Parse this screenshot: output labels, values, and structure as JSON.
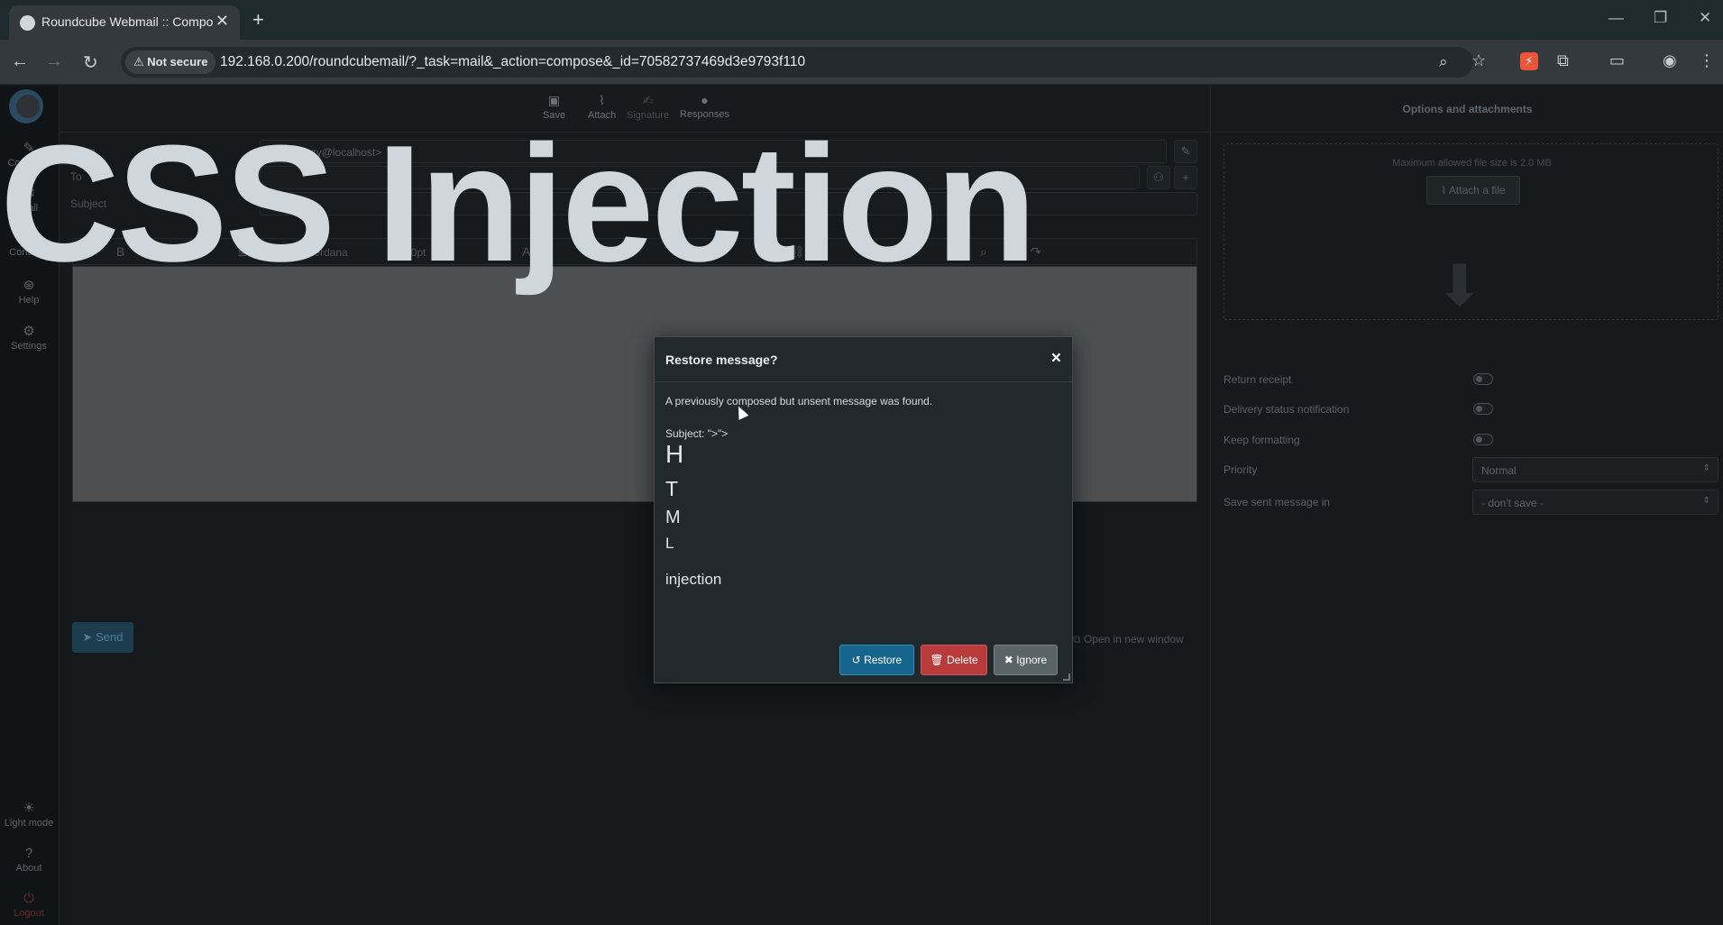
{
  "browser": {
    "tab_title": "Roundcube Webmail :: Compose",
    "tab_close": "✕",
    "new_tab": "+",
    "not_secure": "Not secure",
    "url": "192.168.0.200/roundcubemail/?_task=mail&_action=compose&_id=70582737469d3e9793f110"
  },
  "sidebar": {
    "items": [
      {
        "label": "Compose",
        "icon": "compose-icon"
      },
      {
        "label": "Mail",
        "icon": "mail-icon"
      },
      {
        "label": "Contacts",
        "icon": "contacts-icon"
      },
      {
        "label": "Help",
        "icon": "help-icon"
      },
      {
        "label": "Settings",
        "icon": "gear-icon"
      }
    ],
    "bottom": [
      {
        "label": "Light mode",
        "icon": "sun-icon"
      },
      {
        "label": "About",
        "icon": "question-icon"
      },
      {
        "label": "Logout",
        "icon": "power-icon"
      }
    ]
  },
  "toolbar": {
    "save": "Save",
    "attach": "Attach",
    "signature": "Signature",
    "responses": "Responses"
  },
  "compose": {
    "from_label": "From",
    "from_value": "zazy <zazy@localhost>",
    "to_label": "To",
    "subject_label": "Subject",
    "font_name": "Verdana",
    "font_size": "10pt",
    "send": "Send",
    "open_new_window": "Open in new window"
  },
  "injected_overlay": "CSS Injection",
  "options": {
    "title": "Options and attachments",
    "max_size": "Maximum allowed file size is 2.0 MB",
    "attach_file": "Attach a file",
    "return_receipt": "Return receipt",
    "delivery_status": "Delivery status notification",
    "keep_formatting": "Keep formatting",
    "priority_label": "Priority",
    "priority_value": "Normal",
    "save_sent_label": "Save sent message in",
    "save_sent_value": "- don't save -"
  },
  "dialog": {
    "title": "Restore message?",
    "close": "×",
    "message": "A previously composed but unsent message was found.",
    "subject_line": "Subject: \">\">",
    "injected_lines": [
      "H",
      "T",
      "M",
      "L",
      "injection"
    ],
    "restore": "Restore",
    "delete": "Delete",
    "ignore": "Ignore"
  }
}
